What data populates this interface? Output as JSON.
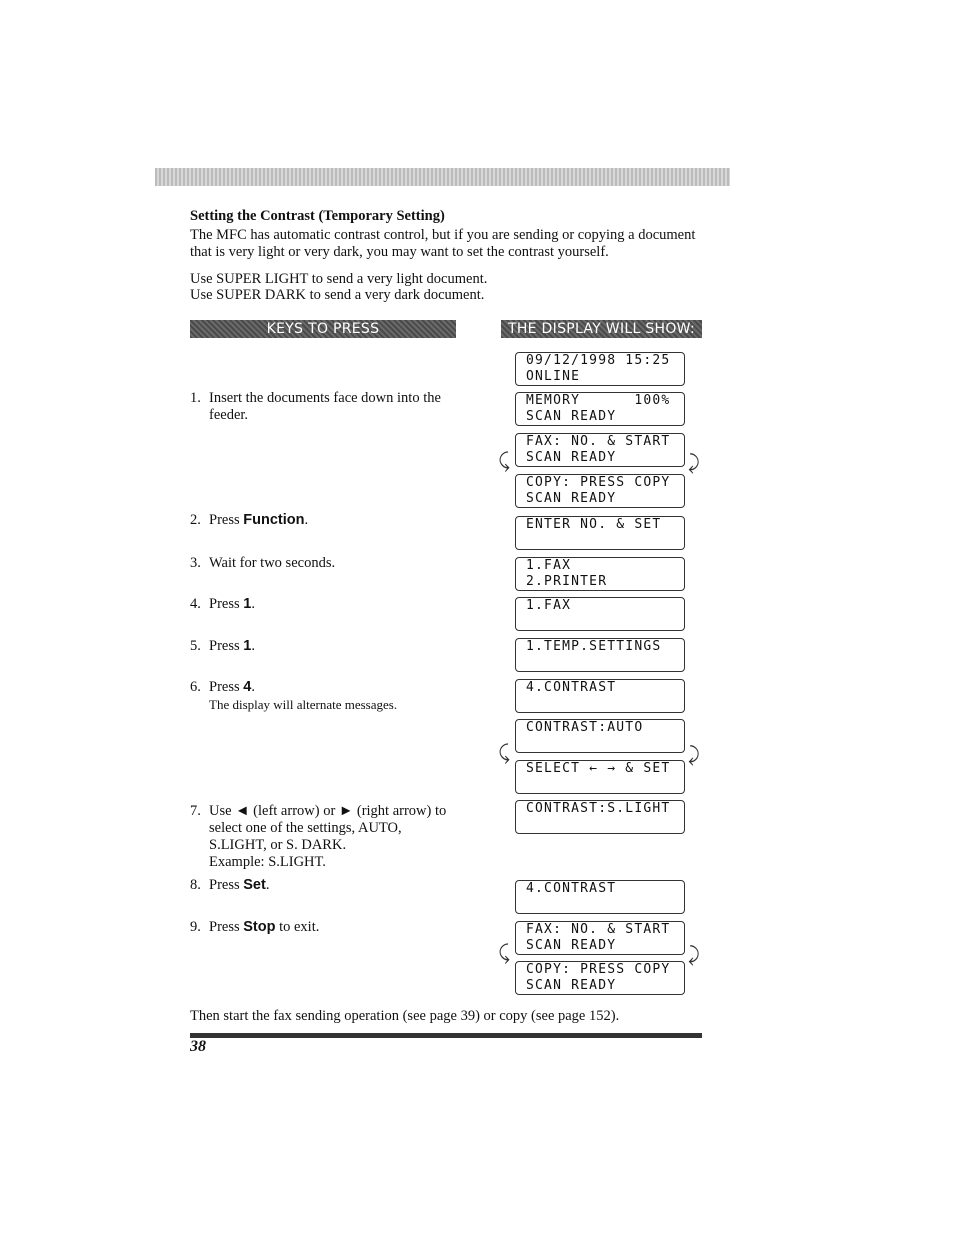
{
  "section_title": "Setting the Contrast (Temporary Setting)",
  "intro": "The MFC has automatic contrast control, but if you are sending or copying a document that is very light or very dark, you may want to set the contrast yourself.",
  "note1": "Use SUPER LIGHT to send a very light document.",
  "note2": "Use SUPER DARK to send a very dark document.",
  "headers": {
    "keys": "KEYS TO PRESS",
    "display": "THE DISPLAY WILL SHOW:"
  },
  "steps": [
    {
      "num": "1.",
      "pre": "Insert the documents face down into the feeder.",
      "key": "",
      "post": ""
    },
    {
      "num": "2.",
      "pre": "Press ",
      "key": "Function",
      "post": "."
    },
    {
      "num": "3.",
      "pre": "Wait for two seconds.",
      "key": "",
      "post": ""
    },
    {
      "num": "4.",
      "pre": "Press ",
      "key": "1",
      "post": "."
    },
    {
      "num": "5.",
      "pre": "Press ",
      "key": "1",
      "post": "."
    },
    {
      "num": "6.",
      "pre": "Press ",
      "key": "4",
      "post": ".",
      "note": "The display will alternate messages."
    },
    {
      "num": "7.",
      "pre": "Use ◄ (left arrow) or ► (right arrow) to select one of the settings, AUTO, S.LIGHT, or S. DARK.",
      "key": "",
      "post": "",
      "note": "Example: S.LIGHT."
    },
    {
      "num": "8.",
      "pre": "Press ",
      "key": "Set",
      "post": "."
    },
    {
      "num": "9.",
      "pre": "Press ",
      "key": "Stop",
      "post": " to exit."
    }
  ],
  "displays": [
    [
      "09/12/1998 15:25",
      "ONLINE"
    ],
    [
      "MEMORY      100%",
      "SCAN READY"
    ],
    [
      "FAX: NO. & START",
      "SCAN READY"
    ],
    [
      "COPY: PRESS COPY",
      "SCAN READY"
    ],
    [
      "ENTER NO. & SET",
      ""
    ],
    [
      "1.FAX",
      "2.PRINTER"
    ],
    [
      "1.FAX",
      ""
    ],
    [
      "1.TEMP.SETTINGS",
      ""
    ],
    [
      "4.CONTRAST",
      ""
    ],
    [
      "CONTRAST:AUTO",
      ""
    ],
    [
      "SELECT ← → & SET",
      ""
    ],
    [
      "CONTRAST:S.LIGHT",
      ""
    ],
    [
      "4.CONTRAST",
      ""
    ],
    [
      "FAX: NO. & START",
      "SCAN READY"
    ],
    [
      "COPY: PRESS COPY",
      "SCAN READY"
    ]
  ],
  "footer": "Then start the fax sending operation (see page 39) or copy (see page 152).",
  "page_number": "38"
}
